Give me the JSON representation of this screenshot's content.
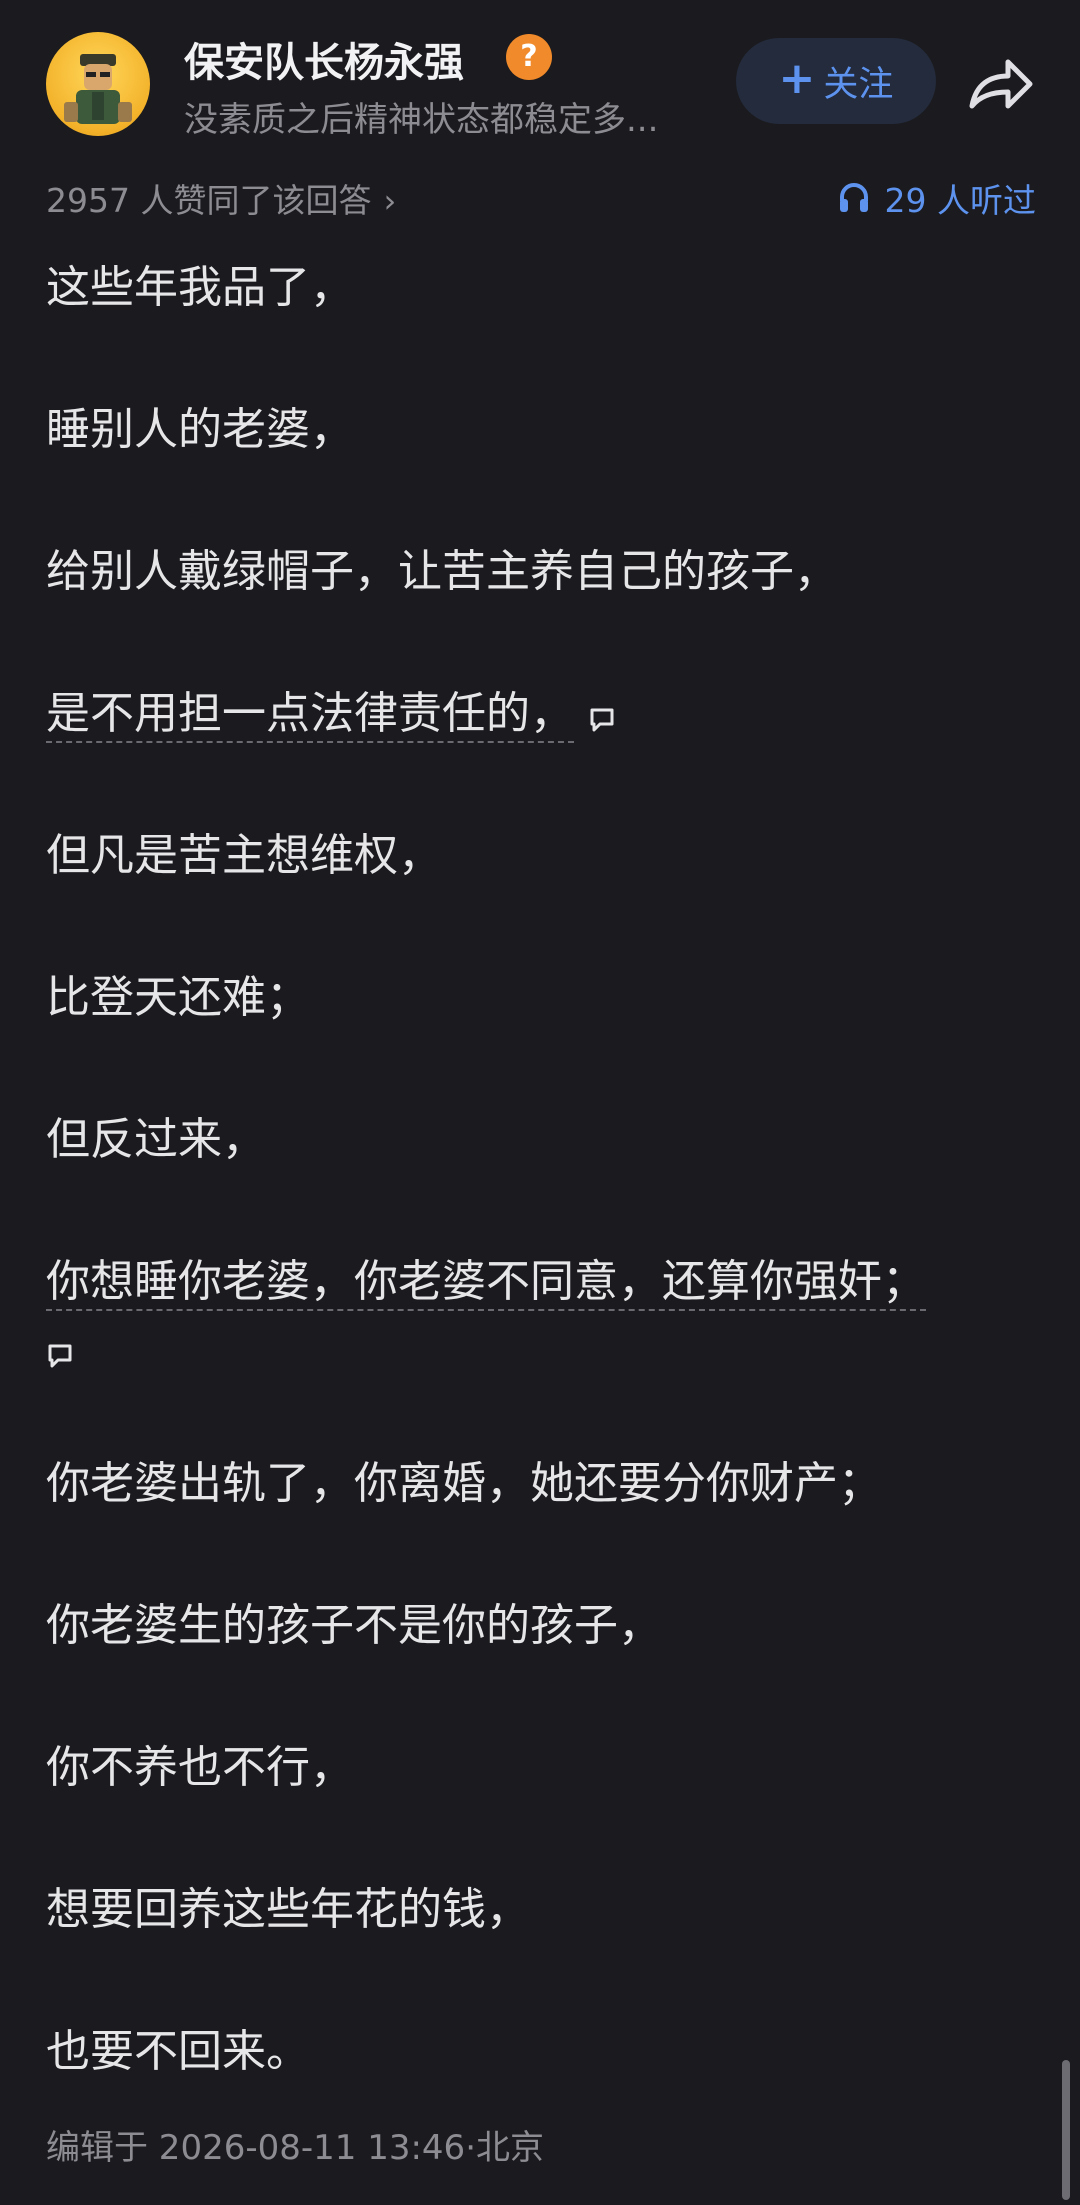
{
  "header": {
    "author_name": "保安队长杨永强",
    "badge_symbol": "?",
    "author_bio": "没素质之后精神状态都稳定多...",
    "follow_label": "关注",
    "follow_plus": "+",
    "share_icon": "share-icon",
    "accent_color": "#5d93ef"
  },
  "meta": {
    "agree_text": "2957 人赞同了该回答",
    "agree_chevron": "›",
    "listen_text": "29 人听过",
    "listen_icon": "headphones-icon"
  },
  "answer": {
    "paragraphs": [
      {
        "text": "这些年我品了，",
        "underlined": false
      },
      {
        "text": "睡别人的老婆，",
        "underlined": false
      },
      {
        "text": "给别人戴绿帽子，让苦主养自己的孩子，",
        "underlined": false
      },
      {
        "text": "是不用担一点法律责任的，",
        "underlined": true
      },
      {
        "text": "但凡是苦主想维权，",
        "underlined": false
      },
      {
        "text": "比登天还难；",
        "underlined": false
      },
      {
        "text": "但反过来，",
        "underlined": false
      },
      {
        "text": "你想睡你老婆，你老婆不同意，还算你强奸；",
        "underlined": true
      },
      {
        "text": "你老婆出轨了，你离婚，她还要分你财产；",
        "underlined": false
      },
      {
        "text": "你老婆生的孩子不是你的孩子，",
        "underlined": false
      },
      {
        "text": "你不养也不行，",
        "underlined": false
      },
      {
        "text": "想要回养这些年花的钱，",
        "underlined": false
      },
      {
        "text": "也要不回来。",
        "underlined": false
      }
    ]
  },
  "footer": {
    "edited_text": "编辑于 2026-08-11 13:46·北京"
  }
}
